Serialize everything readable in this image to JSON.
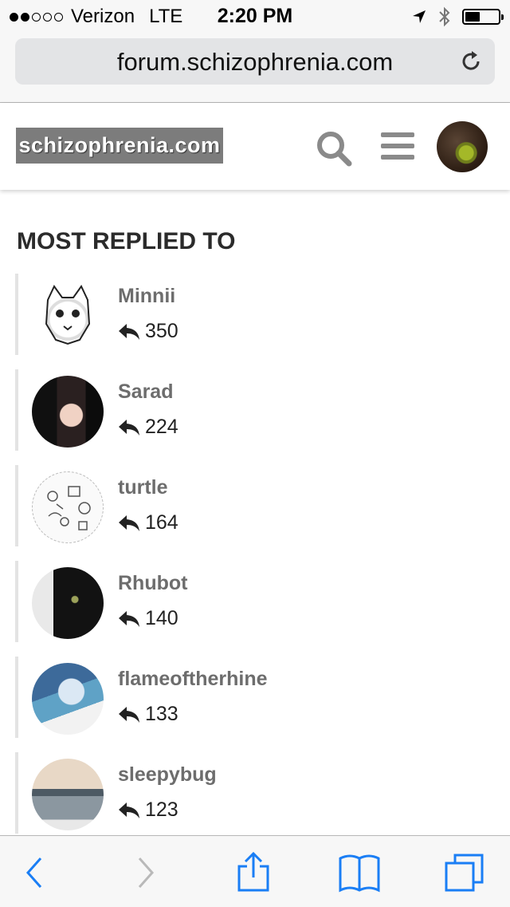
{
  "status_bar": {
    "carrier": "Verizon",
    "network": "LTE",
    "time": "2:20 PM",
    "signal_bars_filled": 2,
    "signal_bars_total": 5,
    "battery_level": 0.45
  },
  "browser": {
    "url": "forum.schizophrenia.com",
    "icons": {
      "reload": "reload-icon",
      "back": "back-icon",
      "forward": "forward-icon",
      "share": "share-icon",
      "bookmarks": "bookmarks-icon",
      "tabs": "tabs-icon"
    },
    "accent_color": "#1a7ef5"
  },
  "site": {
    "logo_text": "schizophrenia.com",
    "icons": [
      "search-icon",
      "menu-icon",
      "user-avatar"
    ]
  },
  "section": {
    "title": "MOST REPLIED TO",
    "users": [
      {
        "name": "Minnii",
        "replies": "350"
      },
      {
        "name": "Sarad",
        "replies": "224"
      },
      {
        "name": "turtle",
        "replies": "164"
      },
      {
        "name": "Rhubot",
        "replies": "140"
      },
      {
        "name": "flameoftherhine",
        "replies": "133"
      },
      {
        "name": "sleepybug",
        "replies": "123"
      }
    ]
  }
}
